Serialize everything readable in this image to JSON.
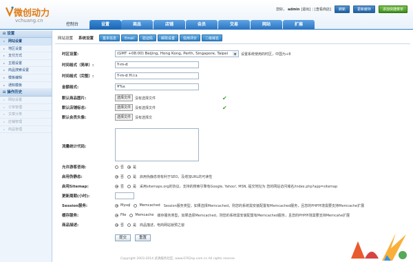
{
  "header": {
    "logo_cn": "微创动力",
    "logo_en": "vchuang.cn",
    "greeting": "您好，",
    "username": "admin",
    "logout": "[退出]",
    "view_store": "[查看商店]",
    "refresh": "刷新",
    "update_cache": "更新缓存",
    "shortcut": "添加快捷菜单"
  },
  "nav": {
    "console": "控制台",
    "items": [
      "设置",
      "商品",
      "店铺",
      "会员",
      "交易",
      "网站",
      "扩展"
    ],
    "active_index": 0
  },
  "sidebar": {
    "section1": "设置",
    "section1_items": [
      "网站设置",
      "地区设置",
      "支付方式",
      "主题设置",
      "商品搜索设置",
      "模板编辑",
      "通知模板"
    ],
    "section2": "操作历史",
    "section2_items": [
      "网站设置",
      "订单管理",
      "文章分类",
      "店铺管理",
      "商品管理"
    ]
  },
  "tabs": {
    "label1": "网站设置",
    "label2": "系统设置",
    "buttons": [
      "基本信息",
      "Email",
      "验证码",
      "邮政设置",
      "信用评价",
      "二级域名"
    ]
  },
  "form": {
    "timezone": {
      "label": "时区设置:",
      "value": "(GMT +08:00) Beijing, Hong Kong, Perth, Singapore, Taipei",
      "hint": "设置系统使用的时区，中国为+8"
    },
    "date_format": {
      "label": "时间格式（简单）:",
      "value": "Y-m-d"
    },
    "datetime_format": {
      "label": "时间格式（完整）:",
      "value": "Y-m-d H:i:s"
    },
    "currency_format": {
      "label": "金额格式:",
      "value": "¥%s"
    },
    "default_goods_image": {
      "label": "默认商品图片:",
      "button": "选择文件",
      "status": "没有选择文件"
    },
    "default_store_logo": {
      "label": "默认店铺标志:",
      "button": "选择文件",
      "status": "没有选择文件"
    },
    "default_avatar": {
      "label": "默认会员头像:",
      "button": "选择文件",
      "status": "没有选择文"
    },
    "stats_code": {
      "label": "流量统计代码:"
    },
    "guest_inquiry": {
      "label": "允许游客咨询:",
      "options": [
        "否",
        "是"
      ],
      "selected": 1
    },
    "rewrite": {
      "label": "启用伪静态:",
      "options": [
        "否",
        "是"
      ],
      "selected": 0,
      "hint": "启用伪静态将有利于SEO，及增加URL的可读性"
    },
    "sitemap": {
      "label": "启用Sitemap:",
      "options": [
        "否",
        "是"
      ],
      "selected": 0,
      "hint": "采用sitemaps.org的协议，支持的搜索引擎有Google, Yahoo!, MSN, 提交地址为 您的网站访问域名/index.php?app=sitemap"
    },
    "update_cycle": {
      "label": "更新周期(小时):",
      "value": ""
    },
    "session": {
      "label": "Session服务:",
      "options": [
        "Mysql",
        "Memcached"
      ],
      "selected": 0,
      "hint": "Session服务类型，如果选择Memcached，则您的系统需安装配置有Memcached服务，且您的PHP环境需要支持Memcache扩展"
    },
    "cache": {
      "label": "缓存服务:",
      "options": [
        "File",
        "Memcache"
      ],
      "selected": 0,
      "hint": "缓存服务类型，如果选择Memcached，则您的系统需安装配置有Memcached服务，且您的PHP环境需要支持Memcahe扩展"
    },
    "goods_qa": {
      "label": "商品描述:",
      "options": [
        "否",
        "是"
      ],
      "selected": 0,
      "hint": "商品描述，电商网站锁预之窗"
    },
    "submit": "提交",
    "reset": "重置"
  },
  "footer": "Copyright 2003-2014 武清服务社区, www.0762ep.com.cn All rights reserve",
  "colors": {
    "brand_orange": "#e07a13",
    "nav_blue": "#2f7fc4",
    "check_green": "#3aa12c"
  }
}
